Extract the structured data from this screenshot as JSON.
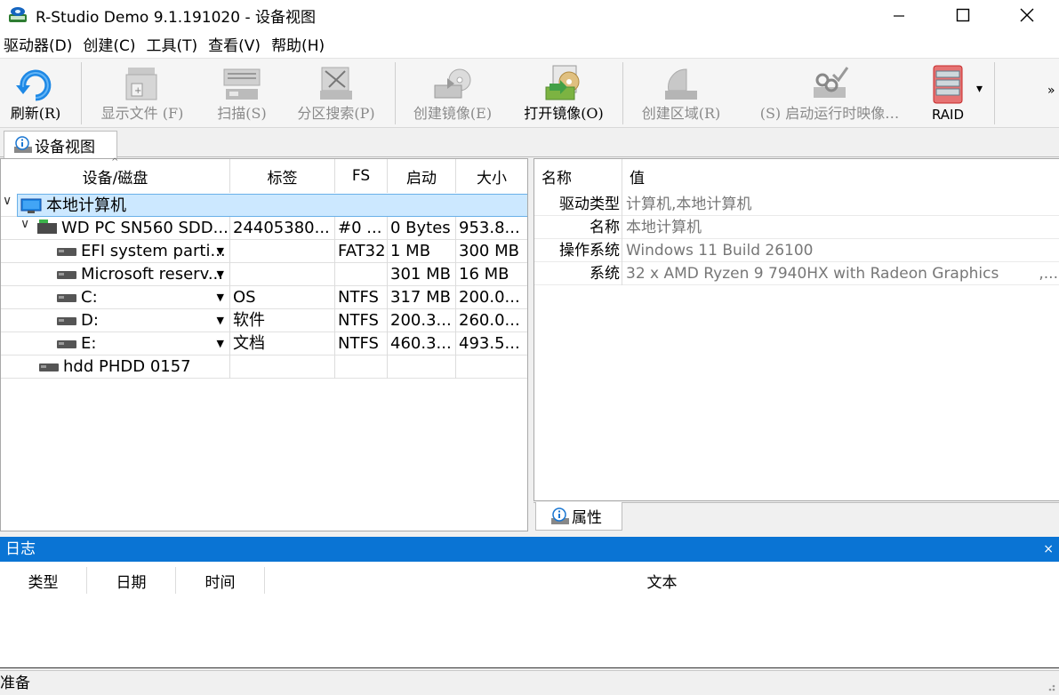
{
  "window": {
    "title": "R-Studio Demo 9.1.191020 - 设备视图",
    "minimize": "—",
    "maximize": "☐",
    "close": "✕"
  },
  "menu": [
    "驱动器(D)",
    "创建(C)",
    "工具(T)",
    "查看(V)",
    "帮助(H)"
  ],
  "toolbar": {
    "refresh": "刷新(R)",
    "show_files": "显示文件 (F)",
    "scan": "扫描(S)",
    "partition_search": "分区搜索(P)",
    "create_image": "创建镜像(E)",
    "open_image": "打开镜像(O)",
    "create_region": "创建区域(R)",
    "runtime_image": "(S) 启动运行时映像…",
    "raid": "RAID",
    "raid_arrow": "▾",
    "overflow": "»"
  },
  "tabs": {
    "device_view": "设备视图"
  },
  "tree": {
    "headers": [
      "设备/磁盘",
      "标签",
      "FS",
      "启动",
      "大小"
    ],
    "rows": [
      {
        "name": "本地计算机",
        "label": "",
        "fs": "",
        "start": "",
        "size": ""
      },
      {
        "name": "WD PC SN560 SDD...",
        "label": "24405380...",
        "fs": "#0 ...",
        "start": "0 Bytes",
        "size": "953.8..."
      },
      {
        "name": "EFI system parti...",
        "label": "",
        "fs": "FAT32",
        "start": "1 MB",
        "size": "300 MB"
      },
      {
        "name": "Microsoft reserv...",
        "label": "",
        "fs": "",
        "start": "301 MB",
        "size": "16 MB"
      },
      {
        "name": "C:",
        "label": "OS",
        "fs": "NTFS",
        "start": "317 MB",
        "size": "200.0..."
      },
      {
        "name": "D:",
        "label": "软件",
        "fs": "NTFS",
        "start": "200.3...",
        "size": "260.0..."
      },
      {
        "name": "E:",
        "label": "文档",
        "fs": "NTFS",
        "start": "460.3...",
        "size": "493.5..."
      },
      {
        "name": "hdd PHDD 0157",
        "label": "",
        "fs": "",
        "start": "",
        "size": ""
      }
    ]
  },
  "properties": {
    "headers": [
      "名称",
      "值"
    ],
    "rows": [
      {
        "name": "驱动类型",
        "value": "计算机,本地计算机"
      },
      {
        "name": "名称",
        "value": "本地计算机"
      },
      {
        "name": "操作系统",
        "value": "Windows 11 Build 26100"
      },
      {
        "name": "系统",
        "value": "32 x AMD Ryzen 9 7940HX with Radeon Graphics",
        "more": ",..."
      }
    ],
    "tab": "属性"
  },
  "log": {
    "title": "日志",
    "close": "×",
    "headers": [
      "类型",
      "日期",
      "时间",
      "文本"
    ]
  },
  "status": {
    "text": "准备"
  }
}
